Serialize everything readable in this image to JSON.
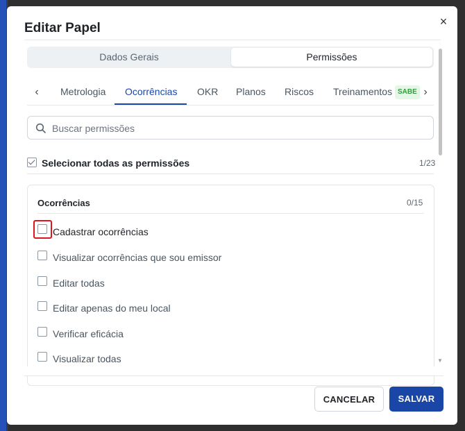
{
  "dialog": {
    "title": "Editar Papel",
    "close_symbol": "×"
  },
  "segments": [
    {
      "label": "Dados Gerais",
      "active": false
    },
    {
      "label": "Permissões",
      "active": true
    }
  ],
  "tabs": {
    "items": [
      {
        "label": "Metrologia"
      },
      {
        "label": "Ocorrências",
        "active": true
      },
      {
        "label": "OKR"
      },
      {
        "label": "Planos"
      },
      {
        "label": "Riscos"
      },
      {
        "label": "Treinamentos"
      }
    ],
    "badge": "SABE",
    "prev_symbol": "‹",
    "next_symbol": "›"
  },
  "search": {
    "placeholder": "Buscar permissões",
    "value": ""
  },
  "select_all": {
    "label": "Selecionar todas as permissões",
    "count": "1/23",
    "checked": true
  },
  "group": {
    "title": "Ocorrências",
    "count": "0/15",
    "permissions": [
      {
        "label": "Cadastrar ocorrências",
        "checked": false
      },
      {
        "label": "Visualizar ocorrências que sou emissor",
        "checked": false
      },
      {
        "label": "Editar todas",
        "checked": false
      },
      {
        "label": "Editar apenas do meu local",
        "checked": false
      },
      {
        "label": "Verificar eficácia",
        "checked": false
      },
      {
        "label": "Visualizar todas",
        "checked": false
      }
    ]
  },
  "footer": {
    "cancel_label": "CANCELAR",
    "save_label": "SALVAR"
  },
  "colors": {
    "primary": "#1a46a8",
    "highlight": "#e0141e",
    "badge_text": "#2e9d3c",
    "badge_bg": "#e5f6e7"
  }
}
